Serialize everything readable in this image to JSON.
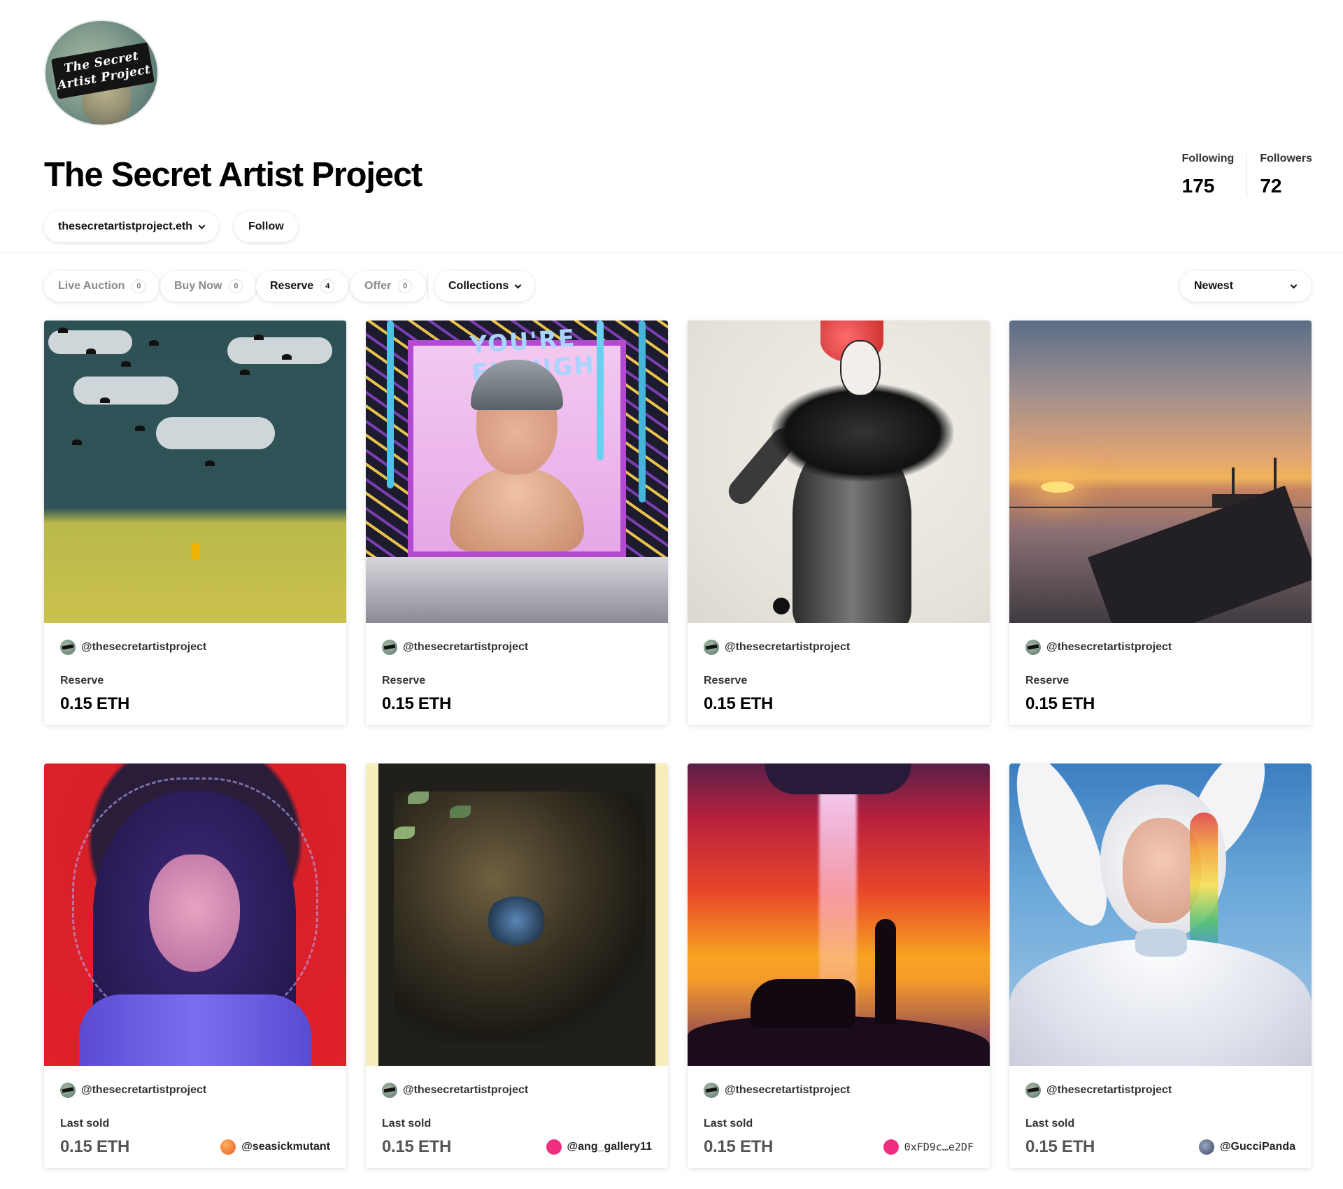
{
  "profile": {
    "avatar_text_line1": "The Secret",
    "avatar_text_line2": "Artist Project",
    "name": "The Secret Artist Project",
    "ens": "thesecretartistproject.eth",
    "follow_label": "Follow",
    "stats": {
      "following_label": "Following",
      "following_value": "175",
      "followers_label": "Followers",
      "followers_value": "72"
    }
  },
  "filters": {
    "live_auction": {
      "label": "Live Auction",
      "count": "0"
    },
    "buy_now": {
      "label": "Buy Now",
      "count": "0"
    },
    "reserve": {
      "label": "Reserve",
      "count": "4"
    },
    "offer": {
      "label": "Offer",
      "count": "0"
    },
    "collections_label": "Collections",
    "sort_value": "Newest"
  },
  "cards": [
    {
      "creator": "@thesecretartistproject",
      "price_label": "Reserve",
      "price": "0.15 ETH",
      "buyer": ""
    },
    {
      "creator": "@thesecretartistproject",
      "price_label": "Reserve",
      "price": "0.15 ETH",
      "buyer": ""
    },
    {
      "creator": "@thesecretartistproject",
      "price_label": "Reserve",
      "price": "0.15 ETH",
      "buyer": ""
    },
    {
      "creator": "@thesecretartistproject",
      "price_label": "Reserve",
      "price": "0.15 ETH",
      "buyer": ""
    },
    {
      "creator": "@thesecretartistproject",
      "price_label": "Last sold",
      "price": "0.15 ETH",
      "buyer": "@seasickmutant"
    },
    {
      "creator": "@thesecretartistproject",
      "price_label": "Last sold",
      "price": "0.15 ETH",
      "buyer": "@ang_gallery11"
    },
    {
      "creator": "@thesecretartistproject",
      "price_label": "Last sold",
      "price": "0.15 ETH",
      "buyer": "0xFD9c…e2DF"
    },
    {
      "creator": "@thesecretartistproject",
      "price_label": "Last sold",
      "price": "0.15 ETH",
      "buyer": "@GucciPanda"
    }
  ],
  "art_text": {
    "card2_title": "YOU'RE ENOUGH"
  },
  "colors": {
    "buyer_dot_1": "#f07a2a",
    "buyer_dot_2": "#ee2f7f",
    "buyer_dot_3": "#ee2f7f",
    "buyer_dot_4": "#4a5a78"
  }
}
